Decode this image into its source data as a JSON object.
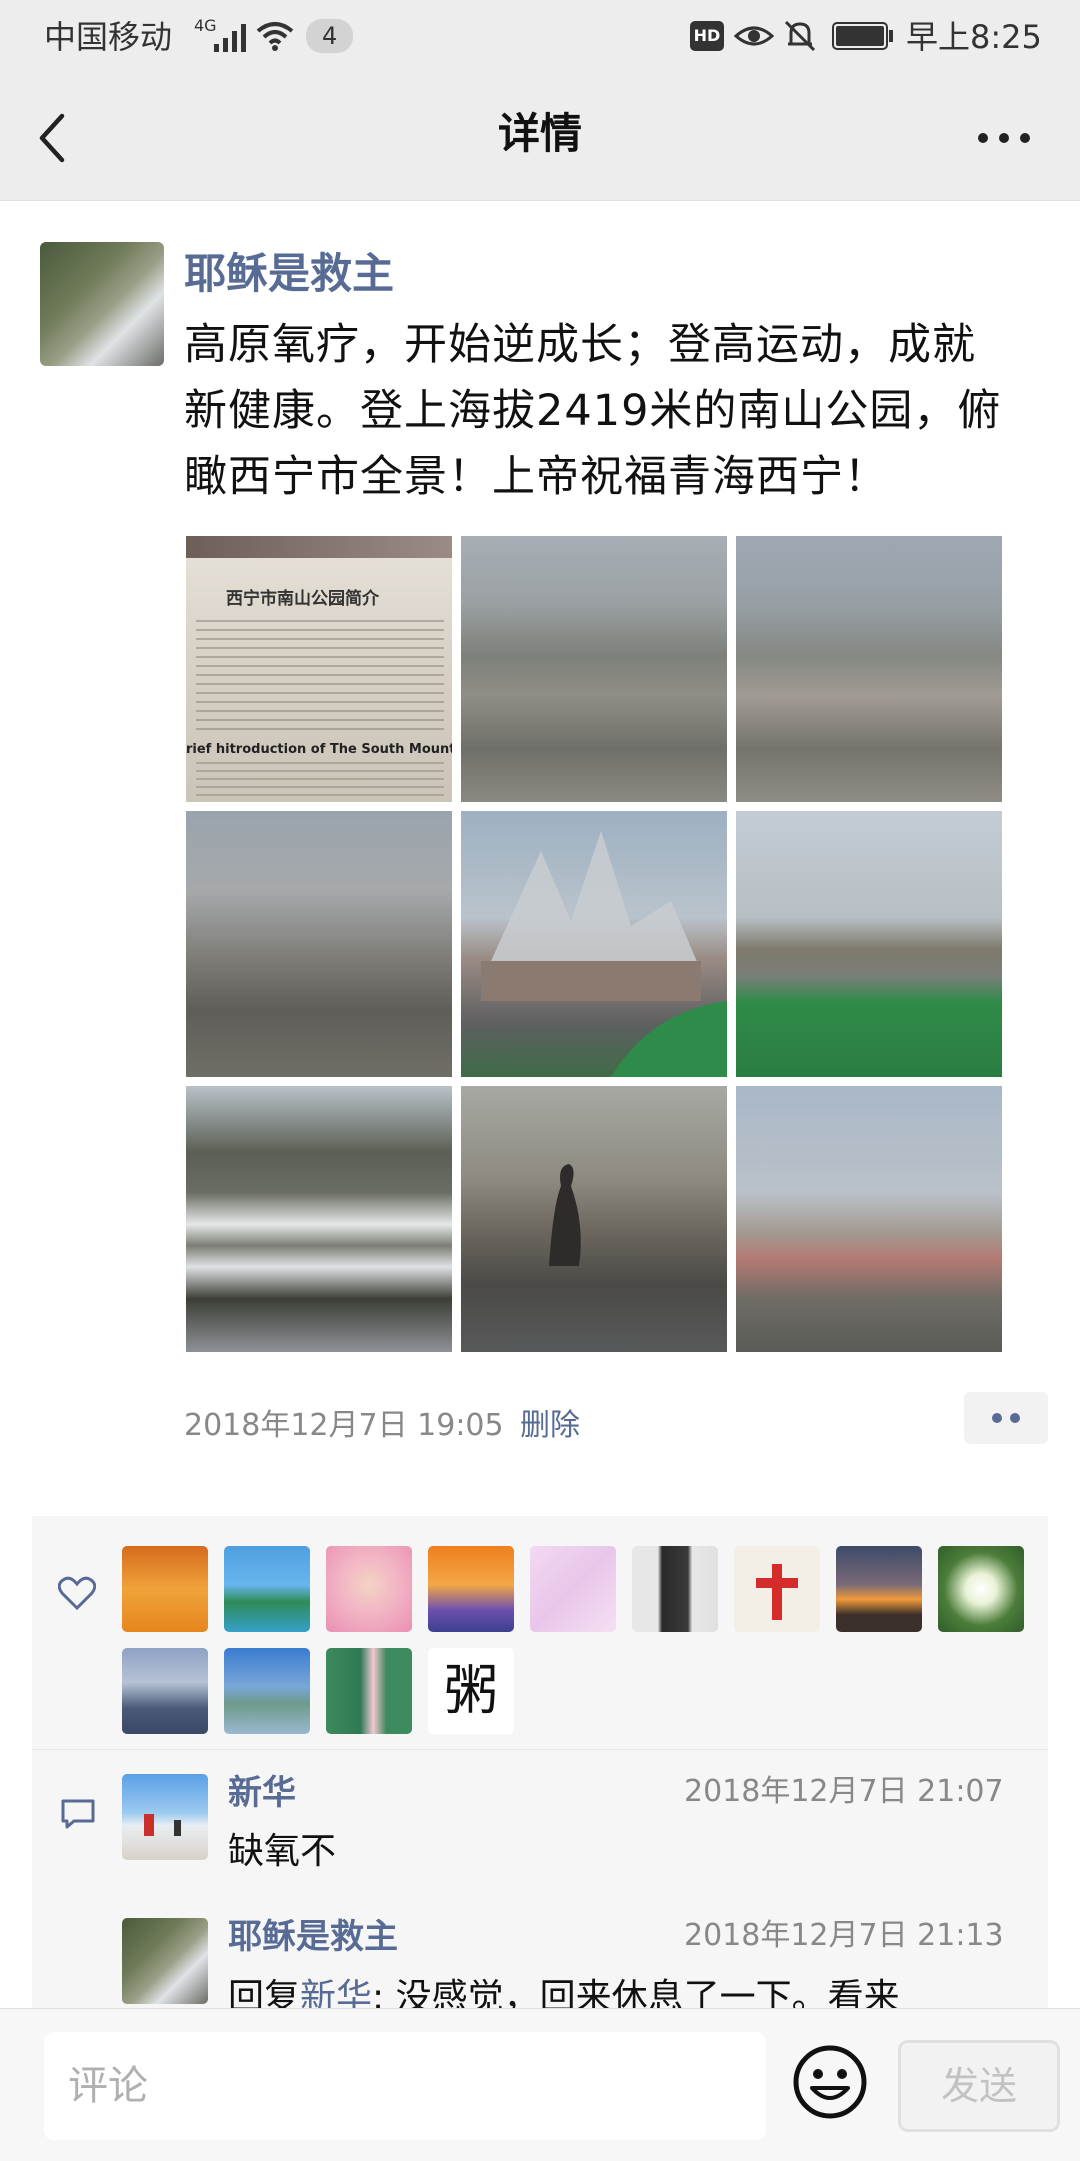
{
  "status_bar": {
    "carrier": "中国移动",
    "network": "4G",
    "notif_count": "4",
    "hd_label": "HD",
    "time": "早上8:25"
  },
  "title_bar": {
    "title": "详情",
    "back_icon": "chevron-left-icon",
    "more_icon": "more-horizontal-icon"
  },
  "post": {
    "author": "耶稣是救主",
    "text_lines": [
      "高原氧疗，开始逆成长；登高运动，成就",
      "新健康。登上海拔2419米的南山公园，俯",
      "瞰西宁市全景！上帝祝福青海西宁！"
    ],
    "photos": [
      {
        "desc": "sign",
        "caption_line1": "西宁市南山公园简介",
        "caption_line2": "rief hitroduction of The South Mountain"
      },
      {
        "desc": "city view"
      },
      {
        "desc": "city view"
      },
      {
        "desc": "hazy housing estate"
      },
      {
        "desc": "pavilion building"
      },
      {
        "desc": "green lawn with gate"
      },
      {
        "desc": "snowy hillside"
      },
      {
        "desc": "bird statue"
      },
      {
        "desc": "city skyline"
      }
    ],
    "time": "2018年12月7日 19:05",
    "delete_label": "删除"
  },
  "likes": {
    "icon": "heart-icon",
    "avatar_text": "粥"
  },
  "comments": [
    {
      "name": "新华",
      "time": "2018年12月7日 21:07",
      "text": "缺氧不"
    },
    {
      "name": "耶稣是救主",
      "time": "2018年12月7日 21:13",
      "reply_prefix": "回复",
      "reply_to": "新华",
      "text": ": 没感觉，回来休息了一下。看来"
    }
  ],
  "bottom_bar": {
    "placeholder": "评论",
    "send_label": "发送",
    "emoji_icon": "smiley-icon"
  },
  "colors": {
    "link": "#576b95",
    "bar_bg": "#ededed"
  }
}
